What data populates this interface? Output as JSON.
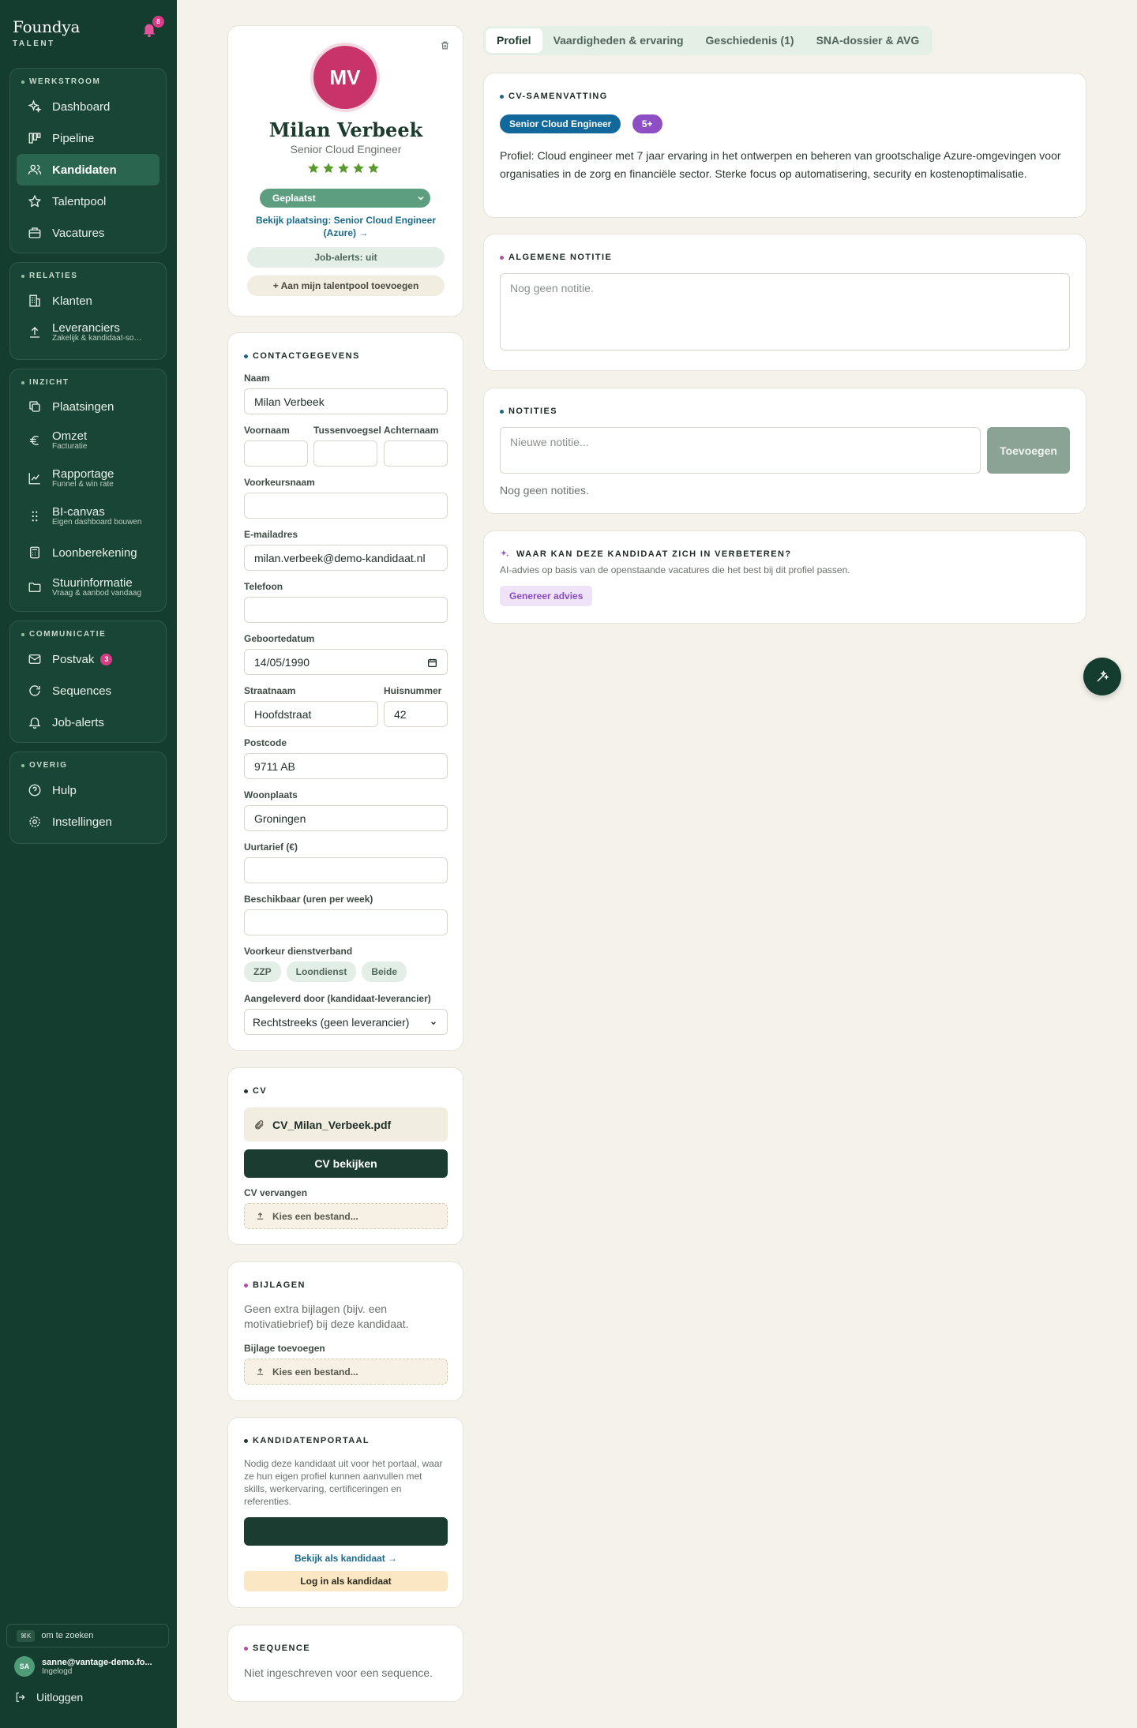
{
  "brand": {
    "name": "Foundya",
    "sub": "TALENT",
    "notifications": "8"
  },
  "sidebar": {
    "groups": [
      {
        "title": "WERKSTROOM",
        "items": [
          {
            "label": "Dashboard",
            "sub": "",
            "icon": "sparkle-icon"
          },
          {
            "label": "Pipeline",
            "sub": "",
            "icon": "kanban-icon"
          },
          {
            "label": "Kandidaten",
            "sub": "",
            "icon": "users-icon"
          },
          {
            "label": "Talentpool",
            "sub": "",
            "icon": "star-icon"
          },
          {
            "label": "Vacatures",
            "sub": "",
            "icon": "briefcase-icon"
          }
        ]
      },
      {
        "title": "RELATIES",
        "items": [
          {
            "label": "Klanten",
            "sub": "",
            "icon": "building-icon"
          },
          {
            "label": "Leveranciers",
            "sub": "Zakelijk & kandidaat-so…",
            "icon": "upload-icon"
          }
        ]
      },
      {
        "title": "INZICHT",
        "items": [
          {
            "label": "Plaatsingen",
            "sub": "",
            "icon": "copy-icon"
          },
          {
            "label": "Omzet",
            "sub": "Facturatie",
            "icon": "euro-icon"
          },
          {
            "label": "Rapportage",
            "sub": "Funnel & win rate",
            "icon": "chart-icon"
          },
          {
            "label": "BI-canvas",
            "sub": "Eigen dashboard bouwen",
            "icon": "grip-icon"
          },
          {
            "label": "Loonberekening",
            "sub": "",
            "icon": "calculator-icon"
          },
          {
            "label": "Stuurinformatie",
            "sub": "Vraag & aanbod vandaag",
            "icon": "folder-icon"
          }
        ]
      },
      {
        "title": "COMMUNICATIE",
        "items": [
          {
            "label": "Postvak",
            "sub": "",
            "icon": "mail-icon",
            "badge": "3"
          },
          {
            "label": "Sequences",
            "sub": "",
            "icon": "refresh-icon"
          },
          {
            "label": "Job-alerts",
            "sub": "",
            "icon": "bell-icon"
          }
        ]
      },
      {
        "title": "OVERIG",
        "items": [
          {
            "label": "Hulp",
            "sub": "",
            "icon": "help-icon"
          },
          {
            "label": "Instellingen",
            "sub": "",
            "icon": "gear-icon"
          }
        ]
      }
    ],
    "search_kbd": "⌘K",
    "search_text": "om te zoeken",
    "user_initials": "SA",
    "user_email": "sanne@vantage-demo.fo...",
    "user_status": "Ingelogd",
    "logout": "Uitloggen"
  },
  "profile": {
    "initials": "MV",
    "name": "Milan Verbeek",
    "role": "Senior Cloud Engineer",
    "rating": 5,
    "status": "Geplaatst",
    "placement_link": "Bekijk plaatsing: Senior Cloud Engineer (Azure) →",
    "job_alerts": "Job-alerts: uit",
    "talentpool_button": "+ Aan mijn talentpool toevoegen"
  },
  "contact": {
    "title": "CONTACTGEGEVENS",
    "naam_label": "Naam",
    "naam": "Milan Verbeek",
    "voornaam_label": "Voornaam",
    "voornaam": "",
    "tussenvoegsel_label": "Tussenvoegsel",
    "tussenvoegsel": "",
    "achternaam_label": "Achternaam",
    "achternaam": "",
    "voorkeursnaam_label": "Voorkeursnaam",
    "voorkeursnaam": "",
    "email_label": "E-mailadres",
    "email": "milan.verbeek@demo-kandidaat.nl",
    "telefoon_label": "Telefoon",
    "telefoon": "",
    "geboortedatum_label": "Geboortedatum",
    "geboortedatum": "14/05/1990",
    "straat_label": "Straatnaam",
    "straat": "Hoofdstraat",
    "huisnummer_label": "Huisnummer",
    "huisnummer": "42",
    "postcode_label": "Postcode",
    "postcode": "9711 AB",
    "woonplaats_label": "Woonplaats",
    "woonplaats": "Groningen",
    "uurtarief_label": "Uurtarief (€)",
    "uurtarief": "",
    "beschikbaar_label": "Beschikbaar (uren per week)",
    "beschikbaar": "",
    "dienstverband_label": "Voorkeur dienstverband",
    "dienstverband_options": [
      "ZZP",
      "Loondienst",
      "Beide"
    ],
    "leverancier_label": "Aangeleverd door (kandidaat-leverancier)",
    "leverancier": "Rechtstreeks (geen leverancier)"
  },
  "cv": {
    "title": "CV",
    "filename": "CV_Milan_Verbeek.pdf",
    "view_button": "CV bekijken",
    "replace_label": "CV vervangen",
    "choose_file": "Kies een bestand..."
  },
  "bijlagen": {
    "title": "BIJLAGEN",
    "text": "Geen extra bijlagen (bijv. een motivatiebrief) bij deze kandidaat.",
    "add_label": "Bijlage toevoegen",
    "choose_file": "Kies een bestand..."
  },
  "portaal": {
    "title": "KANDIDATENPORTAAL",
    "text": "Nodig deze kandidaat uit voor het portaal, waar ze hun eigen profiel kunnen aanvullen met skills, werkervaring, certificeringen en referenties.",
    "invite_button": "",
    "view_link": "Bekijk als kandidaat →",
    "login_button": "Log in als kandidaat"
  },
  "sequence": {
    "title": "SEQUENCE",
    "text": "Niet ingeschreven voor een sequence."
  },
  "tabs": [
    "Profiel",
    "Vaardigheden & ervaring",
    "Geschiedenis (1)",
    "SNA-dossier & AVG"
  ],
  "summary": {
    "title": "CV-SAMENVATTING",
    "chip_role": "Senior Cloud Engineer",
    "chip_level": "5+",
    "text": "Profiel: Cloud engineer met 7 jaar ervaring in het ontwerpen en beheren van grootschalige Azure-omgevingen voor organisaties in de zorg en financiële sector. Sterke focus op automatisering, security en kostenoptimalisatie."
  },
  "general_note": {
    "title": "ALGEMENE NOTITIE",
    "placeholder": "Nog geen notitie."
  },
  "notes": {
    "title": "NOTITIES",
    "placeholder": "Nieuwe notitie...",
    "add_button": "Toevoegen",
    "empty": "Nog geen notities."
  },
  "advice": {
    "title": "WAAR KAN DEZE KANDIDAAT ZICH IN VERBETEREN?",
    "subtitle": "AI-advies op basis van de openstaande vacatures die het best bij dit profiel passen.",
    "button": "Genereer advies"
  },
  "colors": {
    "sidebar": "#143d30",
    "accent_pink": "#d93b86",
    "link_blue": "#1a6a8c",
    "status_green": "#5e9e80"
  }
}
